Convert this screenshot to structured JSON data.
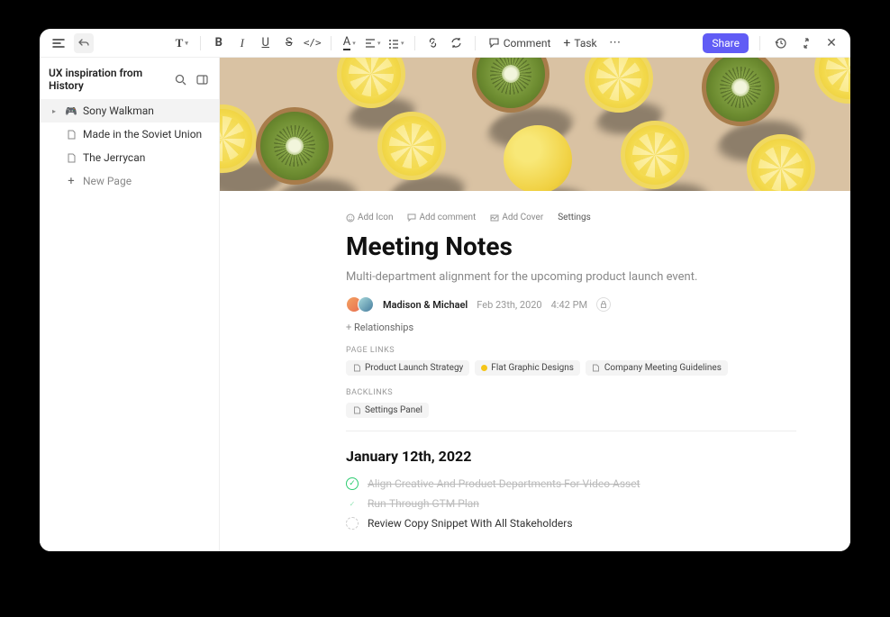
{
  "toolbar": {
    "comment_label": "Comment",
    "task_label": "Task",
    "share_label": "Share"
  },
  "sidebar": {
    "title": "UX inspiration from History",
    "items": [
      {
        "label": "Sony Walkman",
        "icon": "gamepad"
      },
      {
        "label": "Made in the Soviet Union",
        "icon": "page"
      },
      {
        "label": "The Jerrycan",
        "icon": "page"
      }
    ],
    "new_page_label": "New Page"
  },
  "page": {
    "actions": {
      "add_icon": "Add Icon",
      "add_comment": "Add comment",
      "add_cover": "Add Cover",
      "settings": "Settings"
    },
    "title": "Meeting Notes",
    "subtitle": "Multi-department alignment for the upcoming product launch event.",
    "authors": "Madison & Michael",
    "date": "Feb 23th, 2020",
    "time": "4:42 PM",
    "relationships_label": "Relationships",
    "page_links_label": "PAGE LINKS",
    "page_links": [
      {
        "label": "Product Launch Strategy",
        "icon": "page"
      },
      {
        "label": "Flat Graphic Designs",
        "icon": "dot"
      },
      {
        "label": "Company Meeting Guidelines",
        "icon": "page"
      }
    ],
    "backlinks_label": "BACKLINKS",
    "backlinks": [
      {
        "label": "Settings Panel",
        "icon": "page"
      }
    ],
    "section_date": "January 12th, 2022",
    "tasks": [
      {
        "text": "Align Creative And Product Departments For Video Asset",
        "state": "done"
      },
      {
        "text": "Run-Through GTM Plan",
        "state": "partial"
      },
      {
        "text": "Review Copy Snippet With All Stakeholders",
        "state": "open"
      }
    ]
  }
}
